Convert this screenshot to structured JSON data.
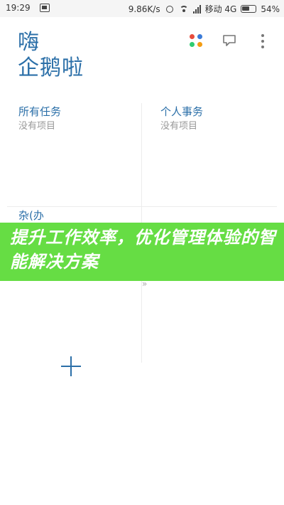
{
  "status_bar": {
    "time": "19:29",
    "network_speed": "9.86K/s",
    "carrier": "移动 4G",
    "battery": "54%"
  },
  "app": {
    "title_line1": "嗨",
    "title_line2": "企鹅啦"
  },
  "toolbar": {
    "apps_icon": "colorful-dots-icon",
    "chat_icon": "chat-bubble-icon",
    "more_icon": "more-vertical-icon"
  },
  "quadrants": [
    {
      "title": "所有任务",
      "subtitle": "没有项目"
    },
    {
      "title": "个人事务",
      "subtitle": "没有项目"
    }
  ],
  "banner": {
    "top_left_fragment": "杂(办",
    "text": "提升工作效率，优化管理体验的智能解决方案",
    "mark": "»"
  },
  "colors": {
    "accent": "#2b6fa8",
    "banner": "#66dd44",
    "dot_red": "#e74c3c",
    "dot_blue": "#3b7bd8",
    "dot_green": "#2ecc71",
    "dot_orange": "#f39c12"
  }
}
